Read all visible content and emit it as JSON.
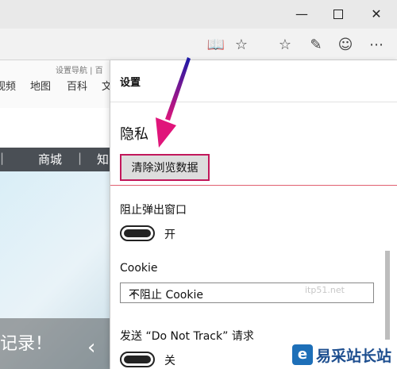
{
  "window": {
    "minimize_glyph": "—",
    "close_glyph": "✕"
  },
  "toolbar": {
    "icons": [
      "reading-view-icon",
      "favorite-star-icon",
      "hub-icon",
      "web-note-icon",
      "feedback-smiley-icon",
      "more-icon"
    ],
    "reading_glyph": "📖",
    "star_glyph": "☆",
    "hub_glyph": "☆",
    "note_glyph": "✎",
    "smile_glyph": "☺",
    "more_glyph": "⋯"
  },
  "webpage": {
    "top_links": [
      "视频",
      "地图",
      "百科",
      "文"
    ],
    "tiny_text": "设置导航 | 百",
    "nav_items": [
      "商城",
      "知"
    ],
    "banner_text": "记录！",
    "chevron": "‹"
  },
  "settings": {
    "title": "设置",
    "privacy_heading": "隐私",
    "clear_button": "清除浏览数据",
    "popup_label": "阻止弹出窗口",
    "popup_state": "开",
    "cookie_label": "Cookie",
    "cookie_value": "不阻止 Cookie",
    "cookie_chevron": "⌄",
    "dnt_label": "发送 “Do Not Track” 请求",
    "dnt_state": "关",
    "watermark": "itp51.net"
  },
  "logo": {
    "mark": "e",
    "name": "易采站长站"
  },
  "colors": {
    "highlight_border": "#c2185b",
    "annotation_arrow": "#1a1aa8"
  }
}
